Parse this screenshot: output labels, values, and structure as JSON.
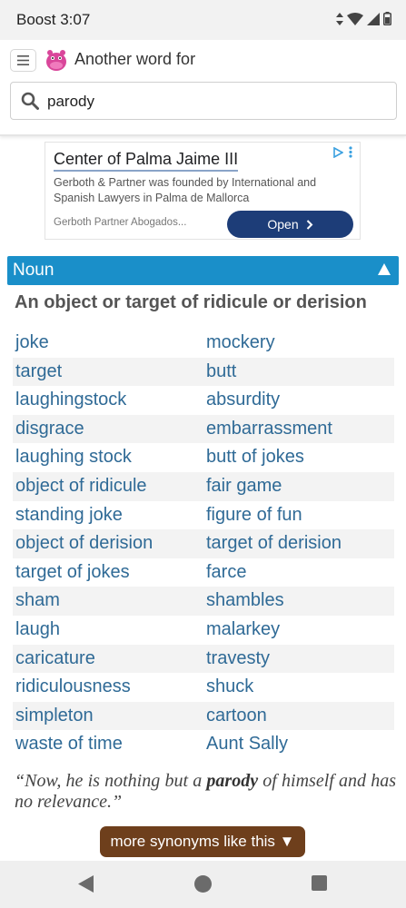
{
  "status_bar": {
    "carrier": "Boost",
    "time": "3:07",
    "icons": [
      "data-arrows-icon",
      "wifi-icon",
      "signal-icon",
      "battery-icon"
    ]
  },
  "header": {
    "app_title": "Another word for",
    "logo_icon": "hippo-logo-icon",
    "menu_icon": "hamburger-icon"
  },
  "search": {
    "value": "parody",
    "icon": "search-icon"
  },
  "ad": {
    "headline": "Center of Palma Jaime III",
    "description": "Gerboth & Partner was founded by International and Spanish Lawyers in Palma de Mallorca",
    "advertiser": "Gerboth Partner Abogados...",
    "button_label": "Open",
    "button_color": "#1d3d78"
  },
  "section": {
    "part_of_speech": "Noun",
    "bar_color": "#1a8fc9",
    "definition": "An object or target of ridicule or derision"
  },
  "synonyms": [
    [
      "joke",
      "mockery"
    ],
    [
      "target",
      "butt"
    ],
    [
      "laughingstock",
      "absurdity"
    ],
    [
      "disgrace",
      "embarrassment"
    ],
    [
      "laughing stock",
      "butt of jokes"
    ],
    [
      "object of ridicule",
      "fair game"
    ],
    [
      "standing joke",
      "figure of fun"
    ],
    [
      "object of derision",
      "target of derision"
    ],
    [
      "target of jokes",
      "farce"
    ],
    [
      "sham",
      "shambles"
    ],
    [
      "laugh",
      "malarkey"
    ],
    [
      "caricature",
      "travesty"
    ],
    [
      "ridiculousness",
      "shuck"
    ],
    [
      "simpleton",
      "cartoon"
    ],
    [
      "waste of time",
      "Aunt Sally"
    ]
  ],
  "example": {
    "before": "“Now, he is nothing but a ",
    "keyword": "parody",
    "after": " of himself and has no relevance.”"
  },
  "more_button": {
    "label": "more synonyms like this ▼",
    "color": "#6e3f1c"
  },
  "nav_bar": {
    "back_icon": "back-triangle-icon",
    "home_icon": "home-circle-icon",
    "recents_icon": "recents-square-icon"
  }
}
